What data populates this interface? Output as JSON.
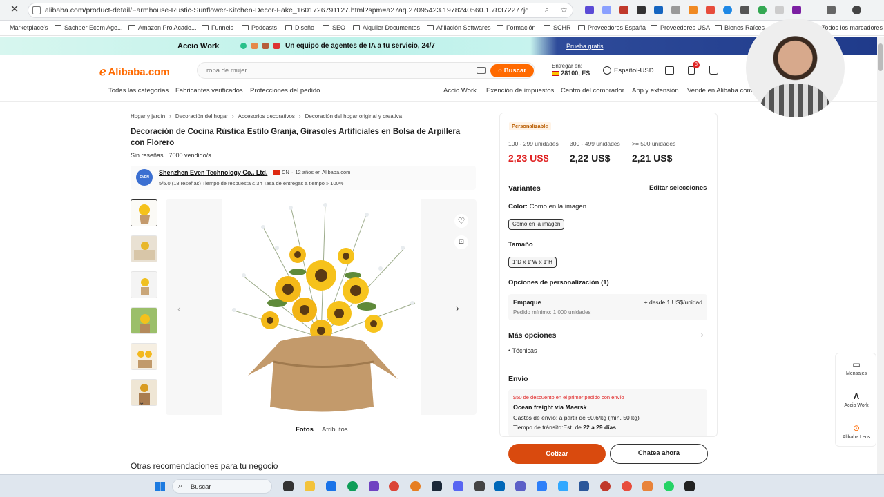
{
  "browser": {
    "url": "alibaba.com/product-detail/Farmhouse-Rustic-Sunflower-Kitchen-Decor-Fake_1601726791127.html?spm=a27aq.27095423.1978240560.1.78372277jdNppl",
    "bookmarks": [
      "Marketplace's",
      "Sachper Ecom Age...",
      "Amazon Pro Acade...",
      "Funnels",
      "Podcasts",
      "Diseño",
      "SEO",
      "Alquiler Documentos",
      "Afiliación Softwares",
      "Formación",
      "SCHR",
      "Proveedores España",
      "Proveedores USA",
      "Bienes Raíces",
      "Todos los marcadores"
    ]
  },
  "promo": {
    "brand": "Accio Work",
    "text": "Un equipo de agentes de IA a tu servicio, 24/7",
    "cta": "Prueba gratis"
  },
  "header": {
    "logo": "Alibaba.com",
    "search_placeholder": "ropa de mujer",
    "search_button": "Buscar",
    "deliver_label": "Entregar en:",
    "deliver_value": "28100, ES",
    "language": "Español-USD",
    "cart_badge": "8"
  },
  "nav": {
    "left": [
      "Todas las categorías",
      "Fabricantes verificados",
      "Protecciones del pedido"
    ],
    "right": [
      "Accio Work",
      "Exención de impuestos",
      "Centro del comprador",
      "App y extensión",
      "Vende en Alibaba.com"
    ]
  },
  "product": {
    "breadcrumb": [
      "Hogar y jardín",
      "Decoración del hogar",
      "Accesorios decorativos",
      "Decoración del hogar original y creativa"
    ],
    "title": "Decoración de Cocina Rústica Estilo Granja, Girasoles Artificiales en Bolsa de Arpillera con Florero",
    "subline": "Sin reseñas · 7000 vendido/s",
    "supplier_name": "Shenzhen Even Technology Co., Ltd.",
    "supplier_logo": "EVEN",
    "supplier_country": "CN",
    "supplier_years": "12 años en Alibaba.com",
    "supplier_stats": "5/5.0 (18 reseñas)    Tiempo de respuesta ≤ 3h    Tasa de entregas a tiempo » 100%",
    "tab_photos": "Fotos",
    "tab_attrs": "Atributos",
    "recommendations": "Otras recomendaciones para tu negocio"
  },
  "panel": {
    "tag": "Personalizable",
    "tiers": [
      {
        "range": "100 - 299 unidades",
        "price": "2,23 US$"
      },
      {
        "range": "300 - 499 unidades",
        "price": "2,22 US$"
      },
      {
        "range": ">= 500 unidades",
        "price": "2,21 US$"
      }
    ],
    "variants": "Variantes",
    "edit": "Editar selecciones",
    "color_label": "Color:",
    "color_value": "Como en la imagen",
    "color_chip": "Como en la imagen",
    "size_label": "Tamaño",
    "size_chip": "1\"D x 1\"W x 1\"H",
    "options_label": "Opciones de personalización (1)",
    "option_name": "Empaque",
    "option_min": "Pedido mínimo: 1.000 unidades",
    "option_price": "+ desde 1 US$/unidad",
    "more_options": "Más opciones",
    "tech": "Técnicas",
    "shipping": "Envío",
    "ship_discount": "$50 de descuento en el primer pedido con envío",
    "ship_name": "Ocean freight vía Maersk",
    "ship_cost": "Gastos de envío: a partir de €0,6/kg (mín. 50 kg)",
    "ship_time_label": "Tiempo de tránsito:Est. de ",
    "ship_time_value": "22 a 29 días",
    "quote": "Cotizar",
    "chat": "Chatea ahora"
  },
  "floating": [
    "Mensajes",
    "Accio Work",
    "Alibaba Lens"
  ],
  "taskbar": {
    "search": "Buscar"
  },
  "colors": {
    "brand": "#ff6a00",
    "price_red": "#e02424",
    "cta": "#d94a0e"
  }
}
